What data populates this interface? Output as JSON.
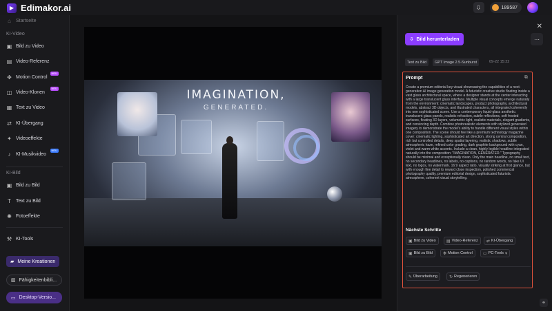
{
  "app": {
    "name": "Edimakor.ai"
  },
  "topbar": {
    "credits": "189587"
  },
  "sidebar": {
    "top_item_label": "Startseite",
    "section_video": "KI-Video",
    "video_items": [
      {
        "label": "Bild zu Video",
        "icon": "image-video-icon"
      },
      {
        "label": "Video-Referenz",
        "icon": "video-ref-icon"
      },
      {
        "label": "Motion Control",
        "icon": "motion-icon",
        "badge": "NEU"
      },
      {
        "label": "Video-Klonen",
        "icon": "clone-icon",
        "badge": "NEU"
      },
      {
        "label": "Text zu Video",
        "icon": "text-video-icon"
      },
      {
        "label": "KI-Übergang",
        "icon": "transition-icon"
      },
      {
        "label": "Videoeffekte",
        "icon": "effects-icon"
      },
      {
        "label": "KI-Musikvideo",
        "icon": "music-icon",
        "badge": "NEU"
      }
    ],
    "section_image": "KI-Bild",
    "image_items": [
      {
        "label": "Bild zu Bild",
        "icon": "image-image-icon"
      },
      {
        "label": "Text zu Bild",
        "icon": "text-image-icon"
      },
      {
        "label": "Fotoeffekte",
        "icon": "photo-effects-icon"
      }
    ],
    "tools_label": "KI-Tools",
    "creations_label": "Meine Kreationen",
    "skills_label": "Fähigkeitenbibli...",
    "desktop_label": "Desktop-Versio..."
  },
  "image": {
    "headline": "IMAGINATION,",
    "subline": "GENERATED."
  },
  "panel": {
    "download_label": "Bild herunterladen",
    "tags": [
      "Text zu Bild",
      "GPT Image 2.5-Sunburst"
    ],
    "date": "09-22 15:22",
    "prompt_title": "Prompt",
    "prompt_text": "Create a premium editorial key visual showcasing the capabilities of a next-generation AI image generation model. A futuristic creative studio floating inside a vast glass architectural space, where a designer stands at the center interacting with a large translucent glass interface. Multiple visual concepts emerge naturally from the environment: cinematic landscapes, product photography, architectural models, abstract 3D objects, and illustrated characters, all integrated coherently into one sophisticated scene. Use a contemporary liquid-glass aesthetic: translucent glass panels, realistic refraction, subtle reflections, soft frosted surfaces, floating 3D layers, volumetric light, realistic materials, elegant gradients, and convincing depth. Combine photorealistic elements with stylized generated imagery to demonstrate the model's ability to handle different visual styles within one composition. The scene should feel like a premium technology magazine cover: cinematic lighting, sophisticated art direction, strong central composition, rich but controlled details, deep spatial layering, realistic shadows, subtle atmospheric haze, refined color grading, dark graphite background with cyan, violet and warm white accents. Include a clean, highly legible headline integrated naturally into the composition: \"IMAGINATION, GENERATED.\" Typography should be minimal and exceptionally clean. Only the main headline, no small text, no secondary headlines, no labels, no captions, no random words, no fake UI text, no logos, no watermark. 16:9 aspect ratio, visually striking at first glance, but with enough fine detail to reward close inspection, polished commercial photography quality, premium editorial design, sophisticated futuristic atmosphere, coherent visual storytelling.",
    "next_title": "Nächste Schritte",
    "next_steps": [
      {
        "label": "Bild zu Video",
        "icon": "image-video-icon"
      },
      {
        "label": "Video-Referenz",
        "icon": "video-ref-icon"
      },
      {
        "label": "KI-Übergang",
        "icon": "transition-icon"
      },
      {
        "label": "Bild zu Bild",
        "icon": "image-image-icon"
      },
      {
        "label": "Motion Control",
        "icon": "motion-icon"
      },
      {
        "label": "PC-Tools",
        "icon": "pc-tools-icon"
      }
    ],
    "actions": [
      {
        "label": "Überarbeitung",
        "icon": "edit-icon"
      },
      {
        "label": "Regenerieren",
        "icon": "refresh-icon"
      }
    ]
  }
}
